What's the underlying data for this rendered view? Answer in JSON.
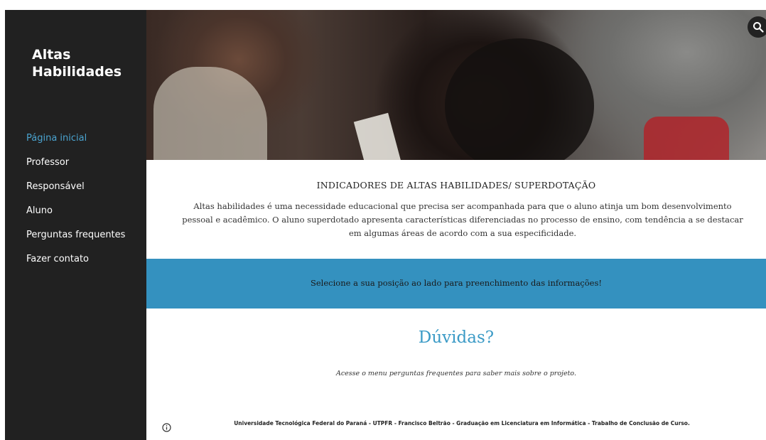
{
  "site": {
    "title": "Altas Habilidades"
  },
  "nav": {
    "items": [
      {
        "label": "Página inicial",
        "active": true
      },
      {
        "label": "Professor",
        "active": false
      },
      {
        "label": "Responsável",
        "active": false
      },
      {
        "label": "Aluno",
        "active": false
      },
      {
        "label": "Perguntas frequentes",
        "active": false
      },
      {
        "label": "Fazer contato",
        "active": false
      }
    ]
  },
  "header": {
    "search_icon": "search-icon"
  },
  "intro": {
    "heading": "INDICADORES DE ALTAS HABILIDADES/ SUPERDOTAÇÃO",
    "text": "Altas habilidades é uma necessidade educacional que precisa ser acompanhada para que o aluno atinja um bom desenvolvimento pessoal e acadêmico. O aluno superdotado apresenta características diferenciadas no processo de ensino, com tendência a se destacar em algumas áreas de acordo com a sua especificidade."
  },
  "banner": {
    "text": "Selecione a sua posição ao lado para preenchimento das informações!"
  },
  "duvidas": {
    "title": "Dúvidas?",
    "text": "Acesse o menu perguntas frequentes para saber mais sobre o projeto."
  },
  "footer": {
    "info_icon": "info-icon",
    "text": "Universidade Tecnológica Federal do Paraná - UTPFR - Francisco Beltrão - Graduação em Licenciatura em Informática - Trabalho de Conclusão de Curso."
  },
  "colors": {
    "sidebar_bg": "#212121",
    "accent": "#3491bf",
    "active_nav": "#4aa3cf",
    "title_blue": "#3a9ac6"
  }
}
